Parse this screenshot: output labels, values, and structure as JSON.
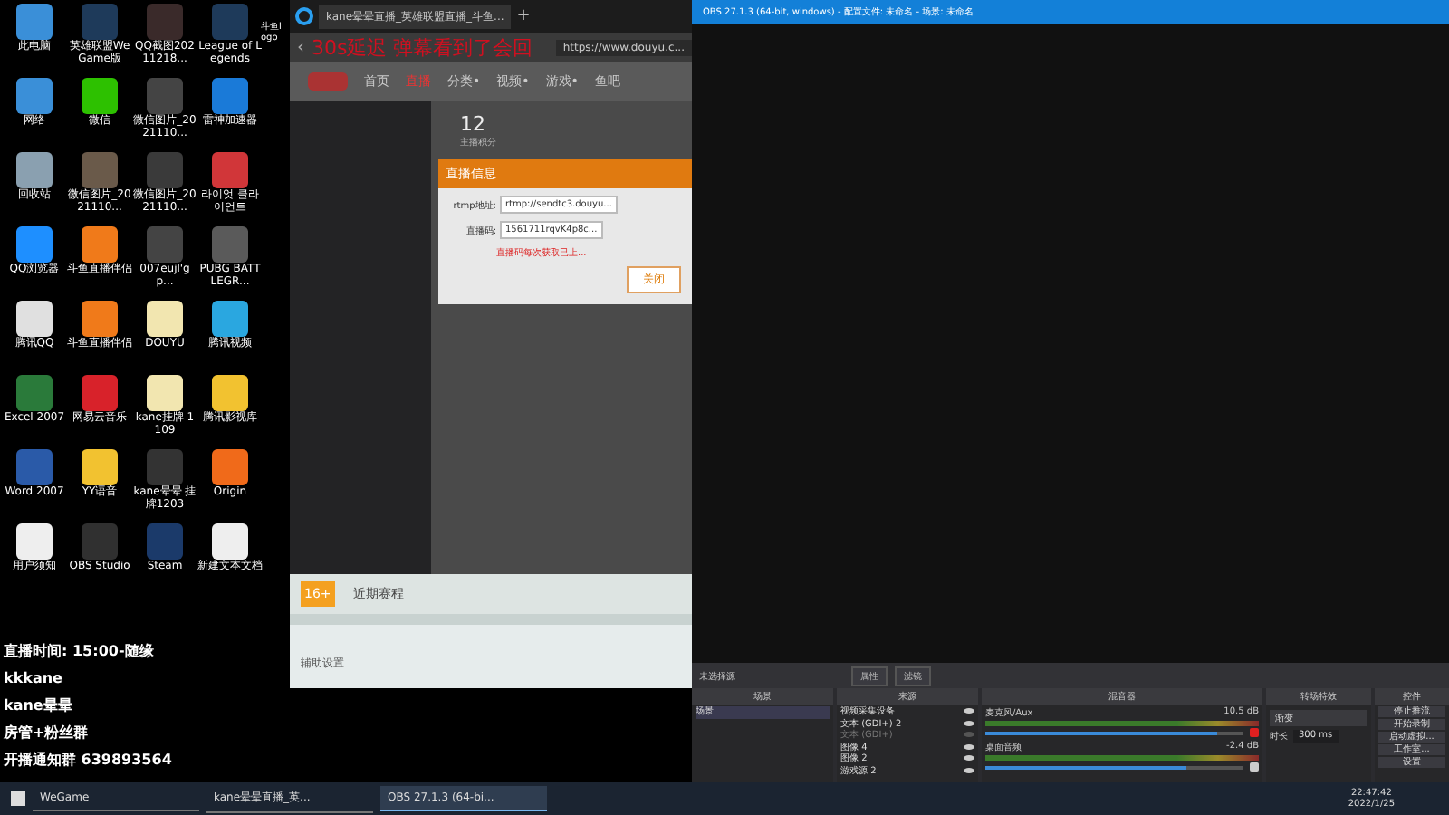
{
  "desktop": {
    "icons": [
      {
        "label": "此电脑",
        "color": "#3a8fd8"
      },
      {
        "label": "英雄联盟WeGame版",
        "color": "#1e3a5a"
      },
      {
        "label": "QQ截图20211218...",
        "color": "#3a2a2a"
      },
      {
        "label": "League of Legends",
        "color": "#1e3a5a"
      },
      {
        "label": "网络",
        "color": "#3a8fd8"
      },
      {
        "label": "微信",
        "color": "#2dc100"
      },
      {
        "label": "微信图片_2021110...",
        "color": "#444444"
      },
      {
        "label": "雷神加速器",
        "color": "#1a7ad8"
      },
      {
        "label": "回收站",
        "color": "#8aa0b0"
      },
      {
        "label": "微信图片_2021110...",
        "color": "#6a5a4a"
      },
      {
        "label": "微信图片_2021110...",
        "color": "#3a3a3a"
      },
      {
        "label": "라이엇 클라이언트",
        "color": "#d13639"
      },
      {
        "label": "QQ浏览器",
        "color": "#1e8fff"
      },
      {
        "label": "斗鱼直播伴侣",
        "color": "#f07a1a"
      },
      {
        "label": "007eujl'gp...",
        "color": "#444444"
      },
      {
        "label": "PUBG BATTLEGR...",
        "color": "#5a5a5a"
      },
      {
        "label": "腾讯QQ",
        "color": "#e0e0e0"
      },
      {
        "label": "斗鱼直播伴侣",
        "color": "#f07a1a"
      },
      {
        "label": "DOUYU",
        "color": "#f2e6b0"
      },
      {
        "label": "腾讯视频",
        "color": "#2aa7e0"
      },
      {
        "label": "Excel 2007",
        "color": "#2a7a3a"
      },
      {
        "label": "网易云音乐",
        "color": "#d8222a"
      },
      {
        "label": "kane挂牌 1109",
        "color": "#f2e6b0"
      },
      {
        "label": "腾讯影视库",
        "color": "#f2c230"
      },
      {
        "label": "Word 2007",
        "color": "#2a5aa8"
      },
      {
        "label": "YY语音",
        "color": "#f2c230"
      },
      {
        "label": "kane晕晕 挂牌1203",
        "color": "#333333"
      },
      {
        "label": "Origin",
        "color": "#f06a1a"
      },
      {
        "label": "用户须知",
        "color": "#eeeeee"
      },
      {
        "label": "OBS Studio",
        "color": "#303030"
      },
      {
        "label": "Steam",
        "color": "#1b3a6a"
      },
      {
        "label": "新建文本文档",
        "color": "#eeeeee"
      }
    ],
    "side_label": "斗鱼logo"
  },
  "browser": {
    "tab": "kane晕晕直播_英雄联盟直播_斗鱼...",
    "new_tab": "+",
    "back": "‹",
    "address": "https://www.douyu.c...",
    "nav": [
      {
        "label": "首页",
        "selected": false
      },
      {
        "label": "直播",
        "selected": true
      },
      {
        "label": "分类•",
        "selected": false
      },
      {
        "label": "视频•",
        "selected": false
      },
      {
        "label": "游戏•",
        "selected": false
      },
      {
        "label": "鱼吧",
        "selected": false
      }
    ],
    "stat": {
      "value": "12",
      "label": "主播积分"
    },
    "dialog": {
      "title": "直播信息",
      "fields": [
        {
          "label": "rtmp地址:",
          "value": "rtmp://sendtc3.douyu..."
        },
        {
          "label": "直播码:",
          "value": "1561711rqvK4p8c..."
        }
      ],
      "warning": "直播码每次获取已上...",
      "button": "关闭"
    },
    "schedule": "近期赛程",
    "age_badge": "16+",
    "settings_link": "辅助设置"
  },
  "overlay_caption": "30s延迟 弹幕看到了会回",
  "obs": {
    "title": "OBS 27.1.3 (64-bit, windows) - 配置文件: 未命名 - 场景: 未命名",
    "no_source": "未选择源",
    "source_buttons": [
      "属性",
      "滤镜"
    ],
    "docks": [
      "场景",
      "来源",
      "混音器",
      "转场特效",
      "控件"
    ],
    "scenes": [
      {
        "label": "场景",
        "selected": true
      }
    ],
    "sources": [
      {
        "label": "视频采集设备",
        "visible": true
      },
      {
        "label": "文本 (GDI+) 2",
        "visible": true
      },
      {
        "label": "文本 (GDI+)",
        "visible": false
      },
      {
        "label": "图像 4",
        "visible": true
      },
      {
        "label": "图像 2",
        "visible": true
      },
      {
        "label": "游戏源 2",
        "visible": true
      }
    ],
    "mixer": [
      {
        "name": "麦克风/Aux",
        "reading": "10.5 dB",
        "level": 0.9,
        "muted": true
      },
      {
        "name": "桌面音频",
        "reading": "-2.4 dB",
        "level": 0.78,
        "muted": false
      }
    ],
    "transition": {
      "value": "渐变",
      "duration_label": "时长",
      "duration": "300 ms"
    },
    "controls": [
      "停止推流",
      "开始录制",
      "启动虚拟...",
      "工作室...",
      "设置"
    ]
  },
  "stream_info": [
    "直播时间: 15:00-随缘",
    "kkkane",
    "kane晕晕",
    "房管+粉丝群",
    "开播通知群 639893564"
  ],
  "taskbar": {
    "apps": [
      {
        "label": "WeGame",
        "selected": false
      },
      {
        "label": "kane晕晕直播_英...",
        "selected": false
      },
      {
        "label": "OBS 27.1.3 (64-bi...",
        "selected": true
      }
    ],
    "time": "22:47:42",
    "date": "2022/1/25"
  }
}
